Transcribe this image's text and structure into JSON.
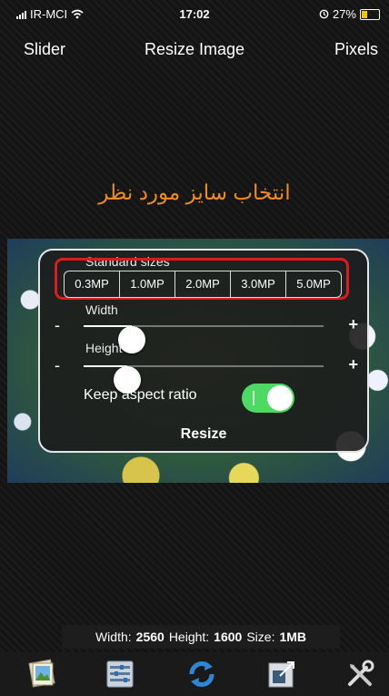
{
  "status_bar": {
    "carrier": "IR-MCI",
    "time": "17:02",
    "battery": "27%"
  },
  "nav": {
    "left": "Slider",
    "title": "Resize Image",
    "right": "Pixels"
  },
  "banner": "انتخاب سایز مورد نظر",
  "panel": {
    "standard_sizes_label": "Standard sizes",
    "sizes": [
      "0.3MP",
      "1.0MP",
      "2.0MP",
      "3.0MP",
      "5.0MP"
    ],
    "width_label": "Width",
    "height_label": "Height",
    "minus": "-",
    "plus": "+",
    "width_level": 0.2,
    "height_level": 0.18,
    "keep_aspect_label": "Keep aspect ratio",
    "keep_aspect_on": true,
    "resize_label": "Resize"
  },
  "info": {
    "width_label": "Width:",
    "width": "2560",
    "height_label": "Height:",
    "height": "1600",
    "size_label": "Size:",
    "size": "1MB"
  },
  "toolbar": [
    "photo-library-icon",
    "settings-list-icon",
    "refresh-icon",
    "resize-image-icon",
    "tools-icon"
  ],
  "colors": {
    "accent": "#f08a24",
    "highlight": "#e0191f",
    "toggle": "#4cd964"
  }
}
